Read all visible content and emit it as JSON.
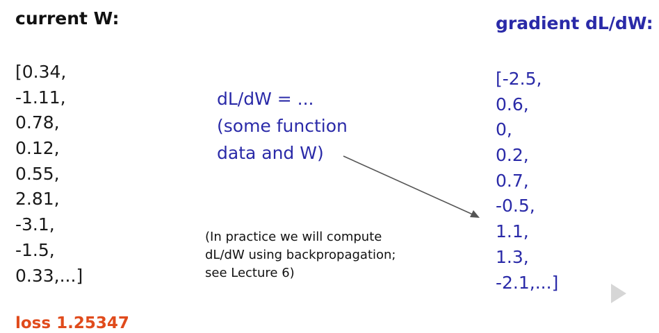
{
  "current_w": {
    "heading": "current W:",
    "values": [
      "[0.34,",
      "-1.11,",
      "0.78,",
      "0.12,",
      "0.55,",
      "2.81,",
      "-3.1,",
      "-1.5,",
      "0.33,...]"
    ]
  },
  "gradient": {
    "heading": "gradient dL/dW:",
    "values": [
      "[-2.5,",
      "0.6,",
      "0,",
      "0.2,",
      "0.7,",
      "-0.5,",
      "1.1,",
      "1.3,",
      "-2.1,...]"
    ]
  },
  "formula": {
    "lines": [
      "dL/dW = ...",
      "(some function",
      "data and W)"
    ]
  },
  "note": {
    "lines": [
      "(In practice we will compute",
      "dL/dW using backpropagation;",
      "see Lecture 6)"
    ]
  },
  "loss": {
    "label": "loss 1.25347"
  },
  "colors": {
    "text": "#111111",
    "accent_blue": "#2a2aa8",
    "loss_orange": "#e04b1c",
    "arrow": "#555555"
  },
  "icons": {
    "arrow": "arrow-icon",
    "player_badge": "play-badge-icon"
  }
}
